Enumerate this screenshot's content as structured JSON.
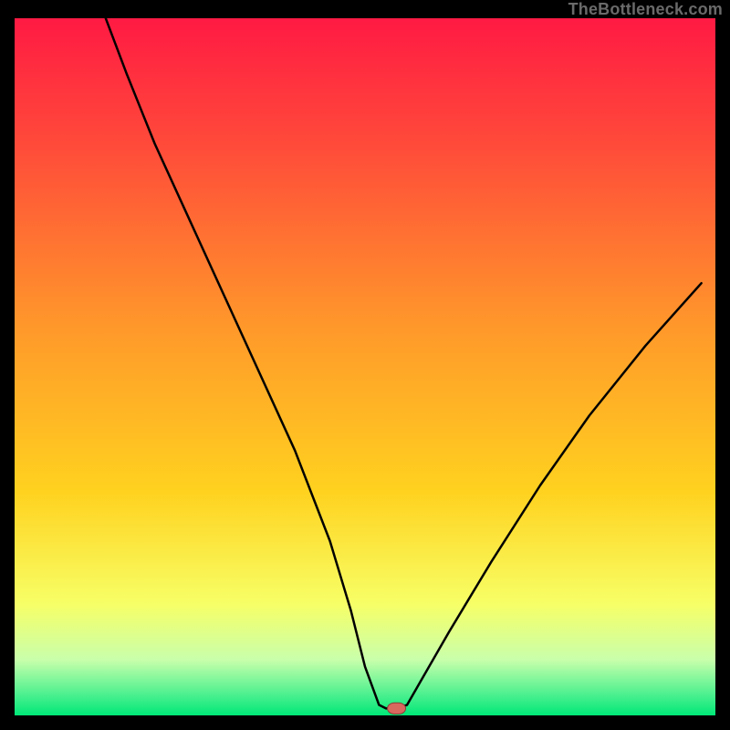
{
  "watermark": "TheBottleneck.com",
  "colors": {
    "frame": "#000000",
    "watermark": "#6a6a6a",
    "curve": "#000000",
    "gradient_top": "#ff1a43",
    "gradient_mid": "#ffc400",
    "gradient_low": "#f7ff66",
    "gradient_bottom": "#00e878",
    "marker_fill": "#d9685f",
    "marker_stroke": "#8b3e37"
  },
  "chart_data": {
    "type": "line",
    "title": "",
    "xlabel": "",
    "ylabel": "",
    "xlim": [
      0,
      100
    ],
    "ylim": [
      0,
      100
    ],
    "series": [
      {
        "name": "bottleneck-curve",
        "x": [
          13,
          16,
          20,
          25,
          30,
          35,
          40,
          45,
          48,
          50,
          52,
          53,
          54.5,
          56,
          58,
          62,
          68,
          75,
          82,
          90,
          98
        ],
        "y": [
          100,
          92,
          82,
          71,
          60,
          49,
          38,
          25,
          15,
          7,
          1.5,
          1,
          1,
          1.5,
          5,
          12,
          22,
          33,
          43,
          53,
          62
        ]
      }
    ],
    "marker": {
      "x": 54.5,
      "y": 1
    },
    "gradient_stops": [
      {
        "pct": 0,
        "color": "#ff1a43"
      },
      {
        "pct": 18,
        "color": "#ff4a3a"
      },
      {
        "pct": 45,
        "color": "#ff9a2a"
      },
      {
        "pct": 68,
        "color": "#ffd21f"
      },
      {
        "pct": 84,
        "color": "#f7ff66"
      },
      {
        "pct": 92,
        "color": "#c9ffab"
      },
      {
        "pct": 97,
        "color": "#4cf08f"
      },
      {
        "pct": 100,
        "color": "#00e878"
      }
    ]
  }
}
